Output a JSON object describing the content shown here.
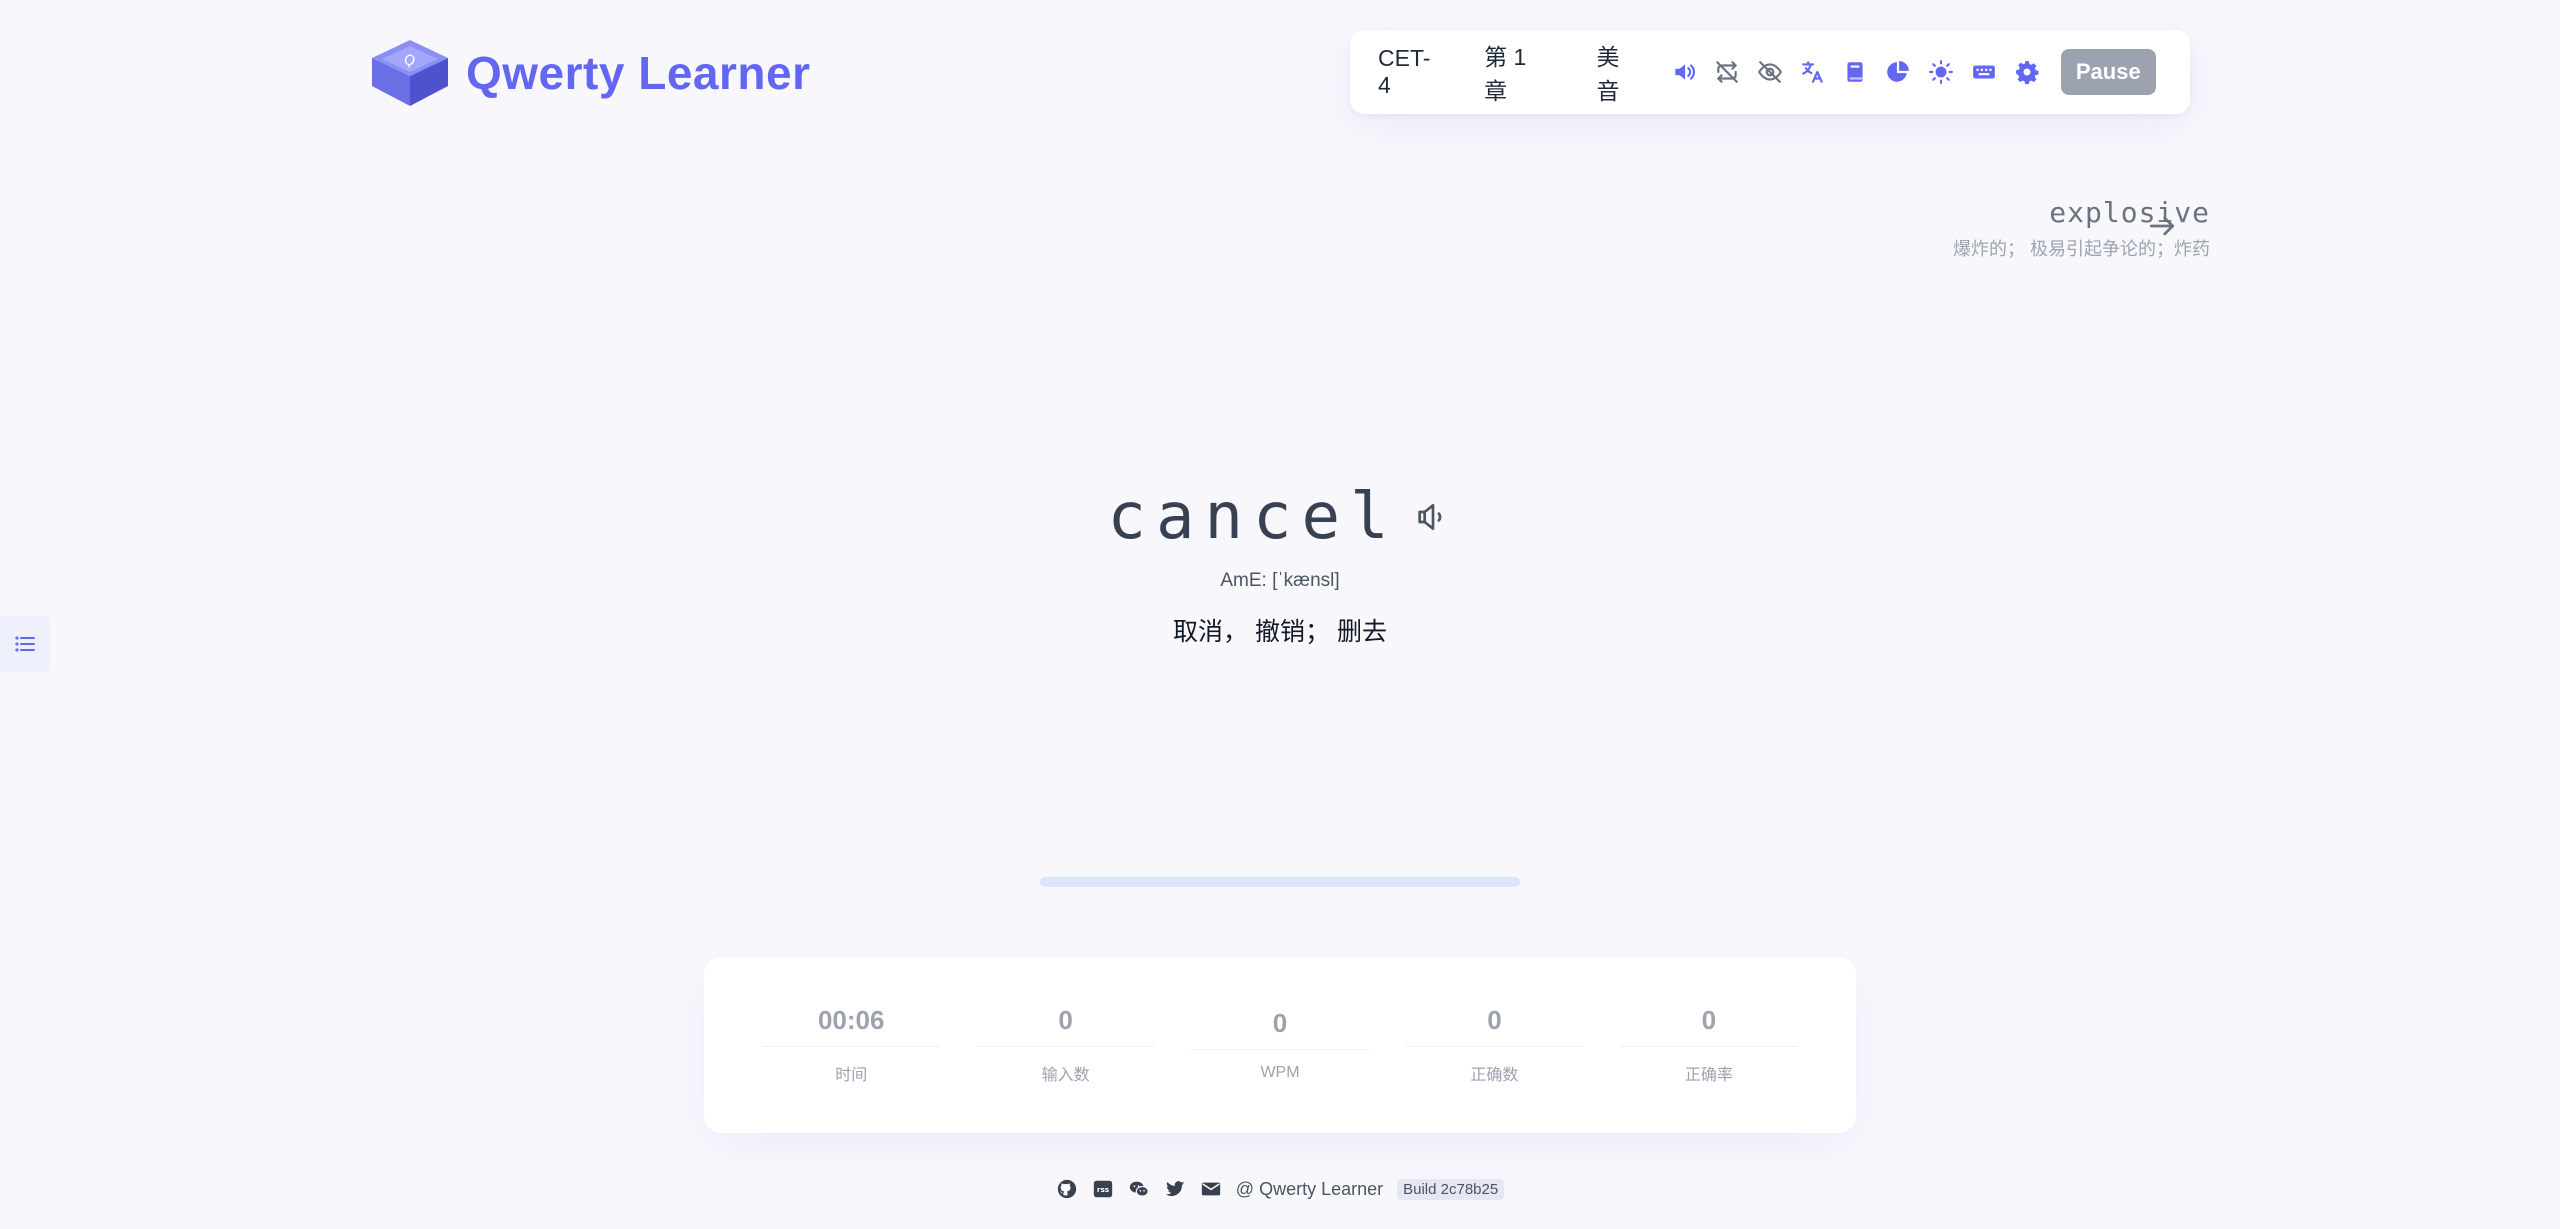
{
  "app": {
    "title": "Qwerty Learner"
  },
  "colors": {
    "accent": "#6366f1",
    "muted": "#9ca3af",
    "background": "#f8f8fc"
  },
  "toolbar": {
    "dictionary": "CET-4",
    "chapter": "第 1 章",
    "pronunciation": "美音",
    "icons": [
      "speaker-icon",
      "loop-off-icon",
      "eye-off-icon",
      "translate-icon",
      "book-icon",
      "pie-chart-icon",
      "sun-icon",
      "keyboard-icon",
      "gear-icon"
    ],
    "pause_label": "Pause"
  },
  "next_word": {
    "word": "explosive",
    "translation": "爆炸的； 极易引起争论的；炸药"
  },
  "current_word": {
    "word": "cancel",
    "phonetic": "AmE: [ˈkænsl]",
    "translation": "取消， 撤销； 删去"
  },
  "progress": {
    "fraction": 0
  },
  "stats": [
    {
      "value": "00:06",
      "label": "时间"
    },
    {
      "value": "0",
      "label": "输入数"
    },
    {
      "value": "0",
      "label": "WPM"
    },
    {
      "value": "0",
      "label": "正确数"
    },
    {
      "value": "0",
      "label": "正确率"
    }
  ],
  "footer": {
    "icons": [
      "github-icon",
      "rss-icon",
      "wechat-icon",
      "twitter-icon",
      "mail-icon"
    ],
    "copyright": "@ Qwerty Learner",
    "build": "Build 2c78b25"
  }
}
